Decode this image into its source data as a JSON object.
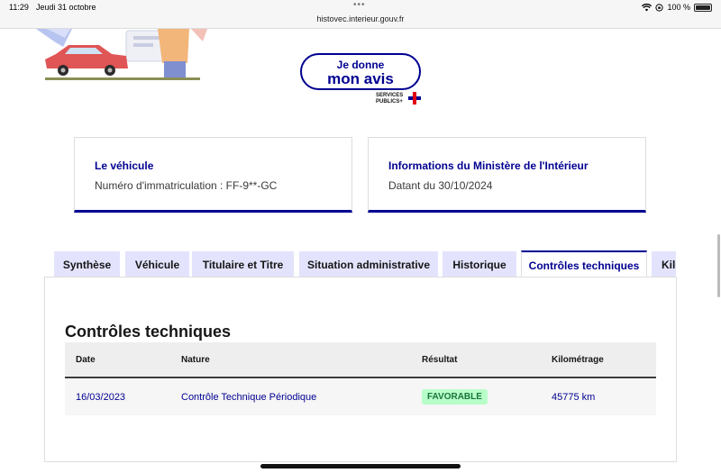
{
  "statusbar": {
    "time": "11:29",
    "date": "Jeudi 31 octobre",
    "url": "histovec.interieur.gouv.fr",
    "battery": "100 %",
    "dots": "•••"
  },
  "avis": {
    "line1": "Je donne",
    "line2": "mon avis",
    "logo_line1": "SERVICES",
    "logo_line2": "PUBLICS+"
  },
  "cards": {
    "vehicle": {
      "title": "Le véhicule",
      "text": "Numéro d'immatriculation : FF-9**-GC"
    },
    "ministry": {
      "title": "Informations du Ministère de l'Intérieur",
      "text": "Datant du 30/10/2024"
    }
  },
  "tabs": [
    {
      "label": "Synthèse"
    },
    {
      "label": "Véhicule"
    },
    {
      "label": "Titulaire et Titre"
    },
    {
      "label": "Situation administrative"
    },
    {
      "label": "Historique"
    },
    {
      "label": "Contrôles techniques"
    },
    {
      "label": "Kilométrage"
    }
  ],
  "active_tab": "Contrôles techniques",
  "section": {
    "title": "Contrôles techniques",
    "headers": [
      "Date",
      "Nature",
      "Résultat",
      "Kilométrage"
    ],
    "rows": [
      {
        "date": "16/03/2023",
        "nature": "Contrôle Technique Périodique",
        "result": "FAVORABLE",
        "km": "45775 km"
      }
    ]
  },
  "colors": {
    "primary": "#000091",
    "tab_bg": "#e3e3fd",
    "badge_bg": "#b8fec9",
    "badge_text": "#18753c"
  }
}
